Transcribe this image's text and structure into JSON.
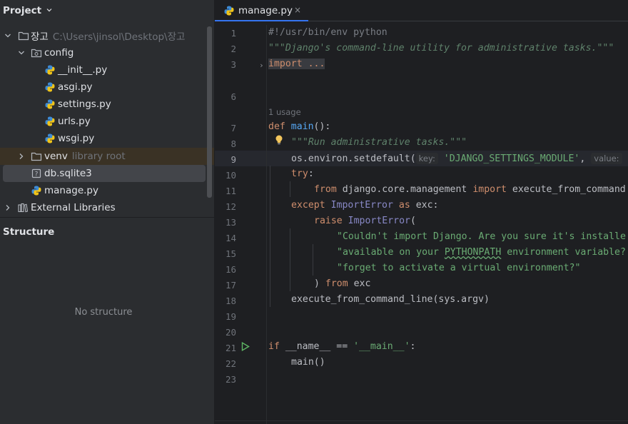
{
  "project_panel": {
    "title": "Project",
    "tree": [
      {
        "label": "장고",
        "hint": "C:\\Users\\jinsol\\Desktop\\장고",
        "icon": "folder-icon"
      },
      {
        "label": "config",
        "hint": "",
        "icon": "package-folder-icon"
      },
      {
        "label": "__init__.py",
        "hint": "",
        "icon": "python-file-icon"
      },
      {
        "label": "asgi.py",
        "hint": "",
        "icon": "python-file-icon"
      },
      {
        "label": "settings.py",
        "hint": "",
        "icon": "python-file-icon"
      },
      {
        "label": "urls.py",
        "hint": "",
        "icon": "python-file-icon"
      },
      {
        "label": "wsgi.py",
        "hint": "",
        "icon": "python-file-icon"
      },
      {
        "label": "venv",
        "hint": "library root",
        "icon": "folder-icon"
      },
      {
        "label": "db.sqlite3",
        "hint": "",
        "icon": "unknown-file-icon"
      },
      {
        "label": "manage.py",
        "hint": "",
        "icon": "python-file-icon"
      },
      {
        "label": "External Libraries",
        "hint": "",
        "icon": "library-icon"
      }
    ]
  },
  "structure_panel": {
    "title": "Structure",
    "empty_text": "No structure"
  },
  "editor": {
    "tab_label": "manage.py",
    "tab_close": "×",
    "usage_hint": "1 usage",
    "line_numbers": [
      "1",
      "2",
      "3",
      "6",
      "7",
      "8",
      "9",
      "10",
      "11",
      "12",
      "13",
      "14",
      "15",
      "16",
      "17",
      "18",
      "19",
      "20",
      "21",
      "22",
      "23"
    ],
    "current_line": "9",
    "lines": {
      "l1": "#!/usr/bin/env python",
      "l2": "\"\"\"Django's command-line utility for administrative tasks.\"\"\"",
      "l3": "import ...",
      "l7_kw": "def",
      "l7_fn": "main",
      "l7_rest": "():",
      "l8": "\"\"\"Run administrative tasks.\"\"\"",
      "l9_a": "os.environ.setdefault(",
      "l9_hint1": "key:",
      "l9_str": "'DJANGO_SETTINGS_MODULE'",
      "l9_b": ",",
      "l9_hint2": "value:",
      "l10": "try",
      "l10_rest": ":",
      "l11_kw1": "from",
      "l11_mod": " django.core.management ",
      "l11_kw2": "import",
      "l11_rest": " execute_from_command",
      "l12_kw1": "except",
      "l12_exc": "ImportError",
      "l12_kw2": "as",
      "l12_rest": " exc:",
      "l13_kw": "raise",
      "l13_exc": "ImportError",
      "l13_rest": "(",
      "l14": "\"Couldn't import Django. Are you sure it's installe",
      "l15_a": "\"available on your ",
      "l15_w": "PYTHONPATH",
      "l15_b": " environment variable?",
      "l16": "\"forget to activate a virtual environment?\"",
      "l17_a": ") ",
      "l17_kw": "from",
      "l17_rest": " exc",
      "l18": "execute_from_command_line(sys.argv)",
      "l21_kw": "if",
      "l21_a": " __name__ == ",
      "l21_str": "'__main__'",
      "l21_b": ":",
      "l22": "main()"
    }
  }
}
